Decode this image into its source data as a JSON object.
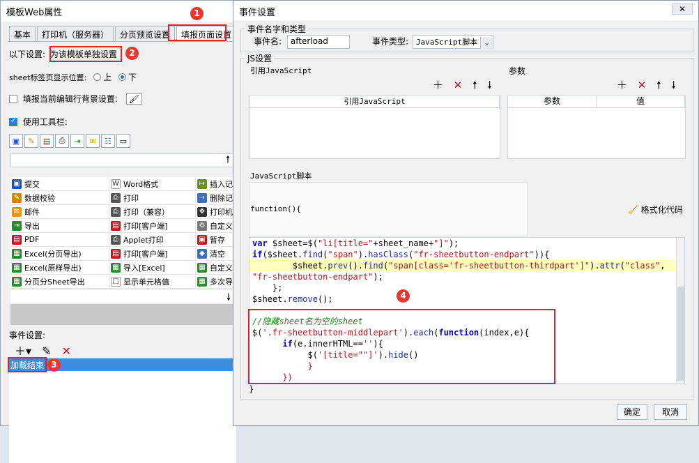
{
  "left": {
    "title": "模板Web属性",
    "tabs": [
      "基本",
      "打印机（服务器）",
      "分页预览设置",
      "填报页面设置"
    ],
    "setting_label": "以下设置:",
    "setting_value": "为该模板单独设置",
    "sheet_pos_label": "sheet标签页显示位置:",
    "sheet_pos_opts": [
      "上",
      "下"
    ],
    "fill_row_bg": "填报当前编辑行背景设置:",
    "use_toolbar": "使用工具栏:",
    "buttons": [
      [
        "提交",
        "Word格式",
        "插入记"
      ],
      [
        "数据校验",
        "打印",
        "删除记"
      ],
      [
        "邮件",
        "打印（兼容）",
        "打印机"
      ],
      [
        "导出",
        "打印[客户端]",
        "自定义"
      ],
      [
        "PDF",
        "Applet打印",
        "暂存"
      ],
      [
        "Excel(分页导出)",
        "打印[客户端]",
        "清空"
      ],
      [
        "Excel(原样导出)",
        "导入[Excel]",
        "自定义"
      ],
      [
        "分页分Sheet导出",
        "显示单元格值",
        "多次导"
      ]
    ],
    "event_label": "事件设置:",
    "event_item": "加载结束",
    "badges": [
      "1",
      "2",
      "3"
    ]
  },
  "dialog": {
    "title": "事件设置",
    "close": "✕",
    "group_name": "事件名字和类型",
    "event_name_label": "事件名:",
    "event_name_value": "afterload",
    "event_type_label": "事件类型:",
    "event_type_value": "JavaScript脚本",
    "js_group": "JS设置",
    "ref_js_title": "引用JavaScript",
    "params_title": "参数",
    "ref_js_col": "引用JavaScript",
    "param_cols": [
      "参数",
      "值"
    ],
    "script_title": "JavaScript脚本",
    "fn_decl": "function(){",
    "format_code": "格式化代码",
    "closing": "}",
    "ok": "确定",
    "cancel": "取消",
    "badge4": "4"
  }
}
